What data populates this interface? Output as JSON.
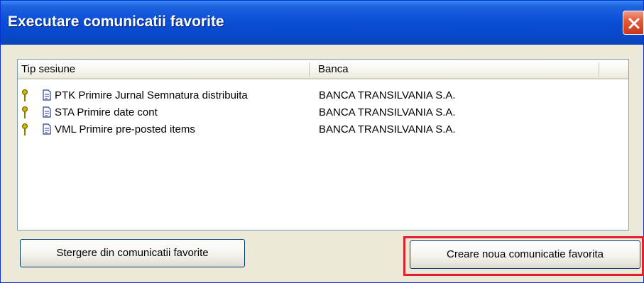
{
  "window": {
    "title": "Executare comunicatii favorite"
  },
  "listview": {
    "columns": [
      "Tip sesiune",
      "Banca"
    ],
    "rows": [
      {
        "tip": "PTK Primire Jurnal Semnatura distribuita",
        "banca": "BANCA TRANSILVANIA S.A."
      },
      {
        "tip": "STA Primire date cont",
        "banca": "BANCA TRANSILVANIA S.A."
      },
      {
        "tip": "VML Primire pre-posted items",
        "banca": "BANCA TRANSILVANIA S.A."
      }
    ]
  },
  "buttons": {
    "delete_label": "Stergere din comunicatii favorite",
    "create_label": "Creare noua comunicatie favorita"
  },
  "colors": {
    "titlebar": "#0a4fd6",
    "window_bg": "#ece9d8",
    "highlight": "#e0212e"
  },
  "icons": {
    "row_pin": "pin-icon",
    "row_doc": "document-icon",
    "close": "close-icon"
  }
}
